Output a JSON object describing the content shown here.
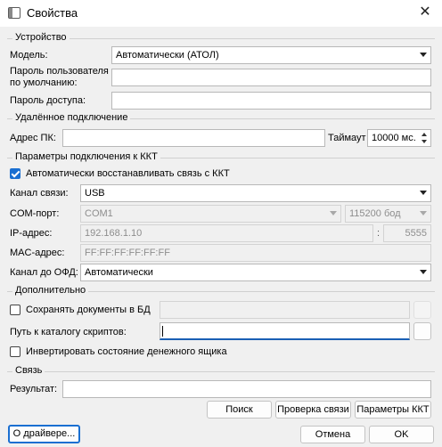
{
  "window": {
    "title": "Свойства",
    "close_glyph": "✕"
  },
  "device": {
    "group_title": "Устройство",
    "model_label": "Модель:",
    "model_value": "Автоматически (АТОЛ)",
    "user_password_label_line1": "Пароль пользователя",
    "user_password_label_line2": "по умолчанию:",
    "user_password_value": "",
    "access_password_label": "Пароль доступа:",
    "access_password_value": ""
  },
  "remote": {
    "group_title": "Удалённое подключение",
    "pc_address_label": "Адрес ПК:",
    "pc_address_value": "",
    "timeout_label": "Таймаут",
    "timeout_value": "10000 мс."
  },
  "kkt": {
    "group_title": "Параметры подключения к ККТ",
    "auto_restore_label": "Автоматически восстанавливать связь с ККТ",
    "auto_restore_checked": true,
    "channel_label": "Канал связи:",
    "channel_value": "USB",
    "com_port_label": "COM-порт:",
    "com_port_value": "COM1",
    "baud_value": "115200 бод",
    "ip_label": "IP-адрес:",
    "ip_value": "192.168.1.10",
    "port_separator": ":",
    "port_value": "5555",
    "mac_label": "MAC-адрес:",
    "mac_value": "FF:FF:FF:FF:FF:FF",
    "ofd_channel_label": "Канал до ОФД:",
    "ofd_channel_value": "Автоматически"
  },
  "extra": {
    "group_title": "Дополнительно",
    "save_docs_label": "Сохранять документы в БД",
    "save_docs_checked": false,
    "save_docs_path": "",
    "scripts_path_label": "Путь к каталогу скриптов:",
    "scripts_path_value": "",
    "invert_drawer_label": "Инвертировать состояние денежного ящика",
    "invert_drawer_checked": false
  },
  "link": {
    "group_title": "Связь",
    "result_label": "Результат:",
    "result_value": "",
    "search_button": "Поиск",
    "check_button": "Проверка связи",
    "kkt_params_button": "Параметры ККТ"
  },
  "footer": {
    "about_button": "О драйвере...",
    "cancel_button": "Отмена",
    "ok_button": "OK"
  },
  "colors": {
    "accent": "#1a6fd1",
    "background": "#f0f0f0"
  }
}
